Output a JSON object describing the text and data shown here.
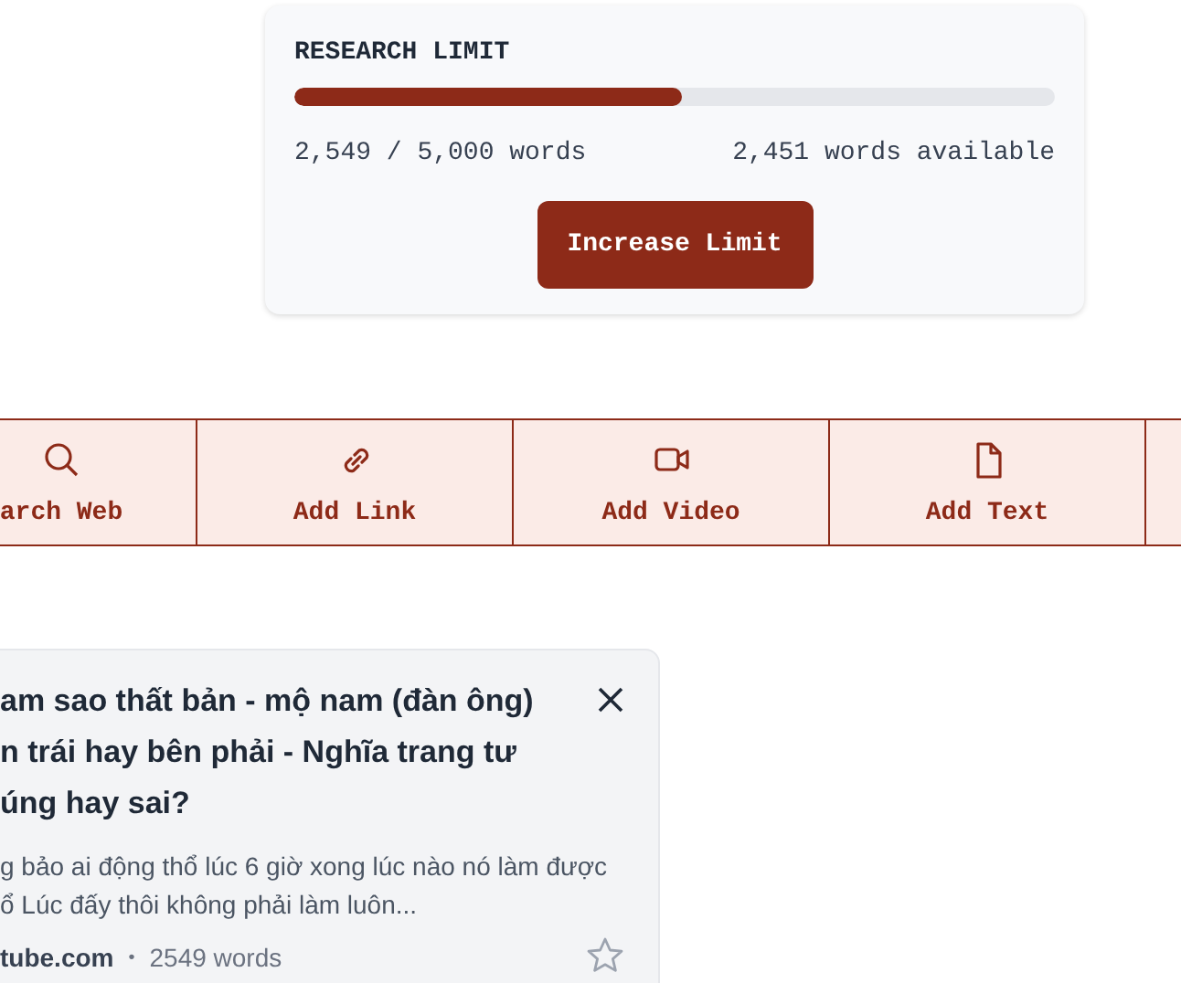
{
  "research_limit": {
    "title": "RESEARCH LIMIT",
    "level": 0.5098,
    "used": "2,549 / 5,000 words",
    "available": "2,451 words available",
    "button": "Increase Limit"
  },
  "toolbar": [
    {
      "label": "arch Web",
      "kind": "search"
    },
    {
      "label": "Add Link",
      "kind": "link"
    },
    {
      "label": "Add Video",
      "kind": "video"
    },
    {
      "label": "Add Text",
      "kind": "text"
    }
  ],
  "source_card": {
    "title_lines": [
      "am sao thất bản - mộ nam (đàn ông)",
      "n trái hay bên phải - Nghĩa trang tư",
      "úng hay sai?"
    ],
    "snippet_lines": [
      "g bảo ai động thổ lúc 6 giờ xong lúc nào nó làm được",
      "ổ Lúc đấy thôi không phải làm luôn..."
    ],
    "domain": "tube.com",
    "separator": "•",
    "word_count": "2549 words",
    "starred": false
  }
}
